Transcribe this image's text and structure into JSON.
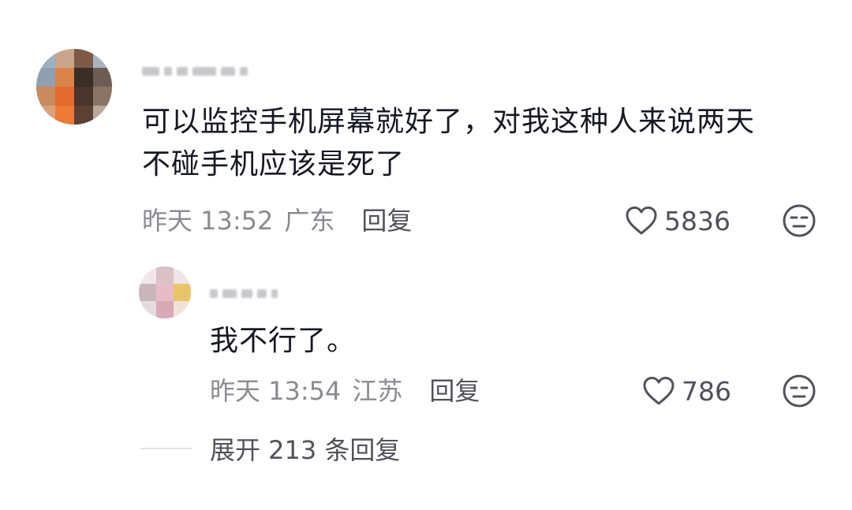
{
  "comment": {
    "avatar_icon": "user-avatar-blurred",
    "username_blurred": true,
    "text_line1": "可以监控手机屏幕就好了，对我这种人来说两天",
    "text_line2": "不碰手机应该是死了",
    "time": "昨天 13:52",
    "location": "广东",
    "reply_label": "回复",
    "like_icon": "heart-outline-icon",
    "like_count": "5836",
    "dislike_icon": "unamused-face-icon"
  },
  "reply": {
    "avatar_icon": "user-avatar-blurred",
    "username_blurred": true,
    "text": "我不行了。",
    "time": "昨天 13:54",
    "location": "江苏",
    "reply_label": "回复",
    "like_icon": "heart-outline-icon",
    "like_count": "786",
    "dislike_icon": "unamused-face-icon"
  },
  "expand": {
    "label": "展开 213 条回复"
  }
}
